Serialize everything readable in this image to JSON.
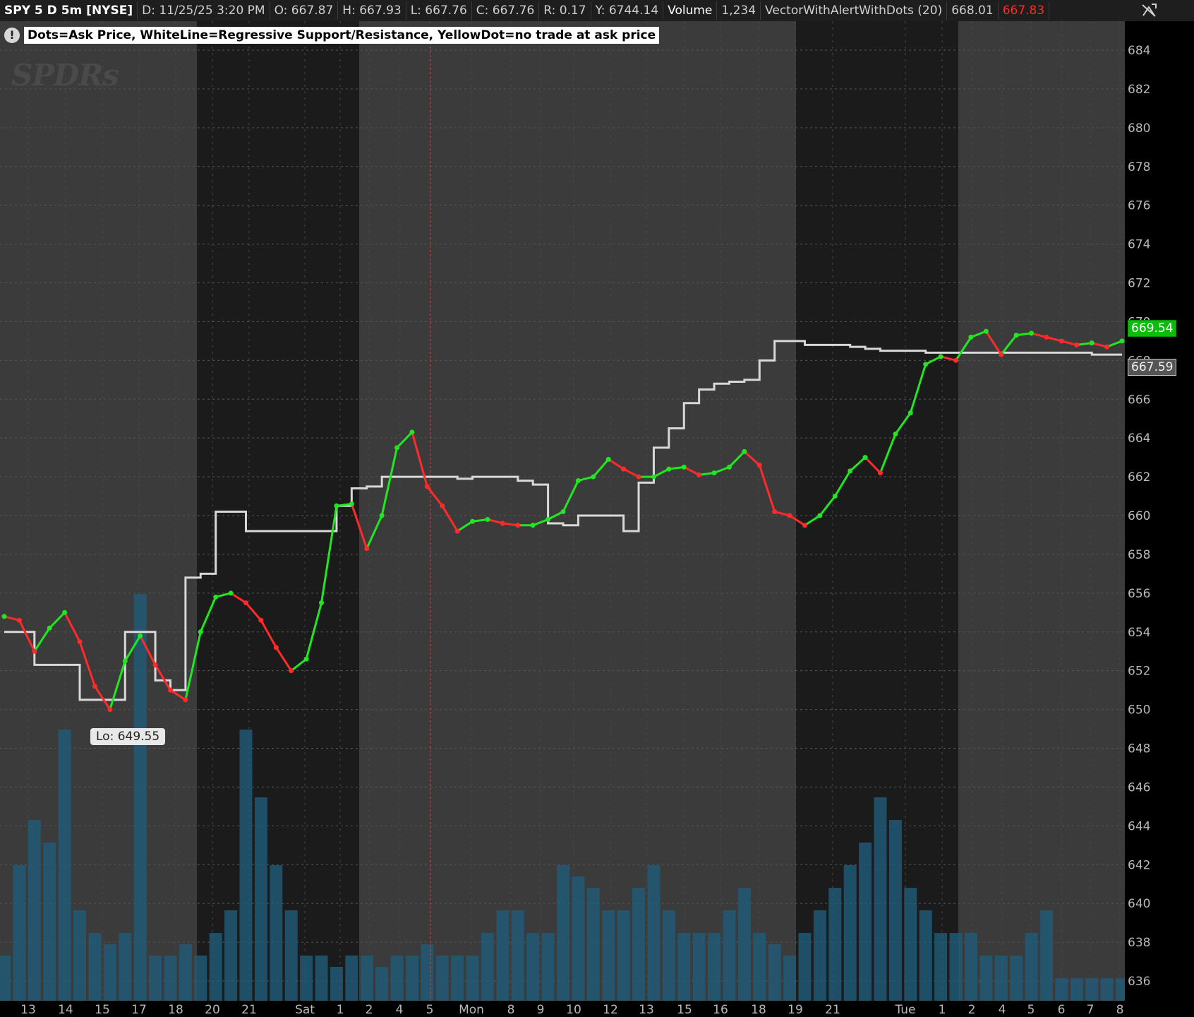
{
  "header": {
    "symbol": "SPY 5 D 5m [NYSE]",
    "date": "D: 11/25/25 3:20 PM",
    "open": "O: 667.87",
    "high": "H: 667.93",
    "low": "L: 667.76",
    "close": "C: 667.76",
    "range": "R: 0.17",
    "y": "Y: 6744.14",
    "volume_label": "Volume",
    "volume_value": "1,234",
    "study": "VectorWithAlertWithDots (20)",
    "study_value_1": "668.01",
    "study_value_2": "667.83",
    "alert_icon": "alert-off-icon"
  },
  "note": {
    "icon": "exclamation-icon",
    "text": "Dots=Ask Price, WhiteLine=Regressive Support/Resistance, YellowDot=no trade at ask price"
  },
  "logo": "SPDRs",
  "labels": {
    "lo": "Lo: 649.55",
    "last_price": "669.54",
    "support_price": "667.59"
  },
  "colors": {
    "background_session": "#3b3b3b",
    "background_extended": "#1b1b1b",
    "up": "#22e622",
    "down": "#ff2a2a",
    "support_line": "#d8d8d8",
    "volume": "#1f5d7a",
    "day_divider": "#ff2a2a"
  },
  "chart_data": {
    "type": "line",
    "title": "SPY 5 D 5m [NYSE]",
    "ylim": [
      635,
      685
    ],
    "y_ticks": [
      "636",
      "638",
      "640",
      "642",
      "644",
      "646",
      "648",
      "650",
      "652",
      "654",
      "656",
      "658",
      "660",
      "662",
      "664",
      "666",
      "668",
      "670",
      "672",
      "674",
      "676",
      "678",
      "680",
      "682",
      "684"
    ],
    "x_ticks": [
      "13",
      "14",
      "15",
      "17",
      "18",
      "20",
      "21",
      "Sat",
      "1",
      "2",
      "4",
      "5",
      "Mon",
      "8",
      "9",
      "10",
      "12",
      "13",
      "15",
      "16",
      "18",
      "19",
      "21",
      "Tue",
      "1",
      "2",
      "4",
      "5",
      "6",
      "7",
      "8"
    ],
    "x": [
      0,
      5,
      10,
      15,
      20,
      25,
      30,
      35,
      40,
      45,
      50,
      55,
      60,
      65,
      70,
      75,
      80,
      85,
      90,
      95,
      100,
      105,
      110,
      115,
      120,
      125,
      130,
      135,
      140,
      145,
      150,
      155,
      160,
      165,
      170,
      175,
      180,
      185,
      190,
      195,
      200,
      205,
      210,
      215,
      220,
      225,
      230,
      235,
      240,
      245,
      250,
      255,
      260,
      265,
      270,
      275,
      280,
      285,
      290,
      295,
      300,
      305,
      310,
      315,
      320,
      325,
      330,
      335,
      340,
      345,
      350,
      355,
      360,
      365,
      370
    ],
    "series": [
      {
        "values": [
          654.8,
          654.6,
          653.0,
          654.2,
          655.0,
          653.5,
          651.2,
          650.0,
          652.5,
          653.8,
          652.3,
          651.0,
          650.5,
          654.0,
          655.8,
          656.0,
          655.5,
          654.6,
          653.2,
          652.0,
          652.6,
          655.5,
          660.5,
          660.6,
          658.3,
          660.0,
          663.5,
          664.3,
          661.5,
          660.5,
          659.2,
          659.7,
          659.8,
          659.6,
          659.5,
          659.5,
          659.8,
          660.2,
          661.8,
          662.0,
          662.9,
          662.4,
          662.0,
          662.0,
          662.4,
          662.5,
          662.1,
          662.2,
          662.5,
          663.3,
          662.6,
          660.2,
          660.0,
          659.5,
          660.0,
          661.0,
          662.3,
          663.0,
          662.2,
          664.2,
          665.3,
          667.8,
          668.2,
          668.0,
          669.2,
          669.5,
          668.3,
          669.3,
          669.4,
          669.2,
          669.0,
          668.8,
          668.9,
          668.7,
          669.0
        ]
      },
      {
        "values": [
          654.0,
          654.0,
          652.3,
          652.3,
          652.3,
          650.5,
          650.5,
          650.5,
          654.0,
          654.0,
          651.5,
          651.0,
          656.8,
          657.0,
          660.2,
          660.2,
          659.2,
          659.2,
          659.2,
          659.2,
          659.2,
          659.2,
          660.5,
          661.4,
          661.5,
          662.0,
          662.0,
          662.0,
          662.0,
          662.0,
          661.9,
          662.0,
          662.0,
          662.0,
          661.8,
          661.6,
          659.6,
          659.5,
          660.0,
          660.0,
          660.0,
          659.2,
          661.7,
          663.5,
          664.5,
          665.8,
          666.5,
          666.8,
          666.9,
          667.0,
          668.0,
          669.0,
          669.0,
          668.8,
          668.8,
          668.8,
          668.7,
          668.6,
          668.5,
          668.5,
          668.5,
          668.4,
          668.4,
          668.4,
          668.4,
          668.4,
          668.4,
          668.4,
          668.4,
          668.4,
          668.4,
          668.4,
          668.3,
          668.3,
          668.3
        ]
      }
    ],
    "volume": [
      20,
      60,
      80,
      70,
      120,
      40,
      30,
      25,
      30,
      180,
      20,
      20,
      25,
      20,
      30,
      40,
      120,
      90,
      60,
      40,
      20,
      20,
      15,
      20,
      20,
      15,
      20,
      20,
      25,
      20,
      20,
      20,
      30,
      40,
      40,
      30,
      30,
      60,
      55,
      50,
      40,
      40,
      50,
      60,
      40,
      30,
      30,
      30,
      40,
      50,
      30,
      25,
      20,
      30,
      40,
      50,
      60,
      70,
      90,
      80,
      50,
      40,
      30,
      30,
      30,
      20,
      20,
      20,
      30,
      40,
      10,
      10,
      10,
      10,
      10
    ],
    "grid": true,
    "legend": "none"
  }
}
